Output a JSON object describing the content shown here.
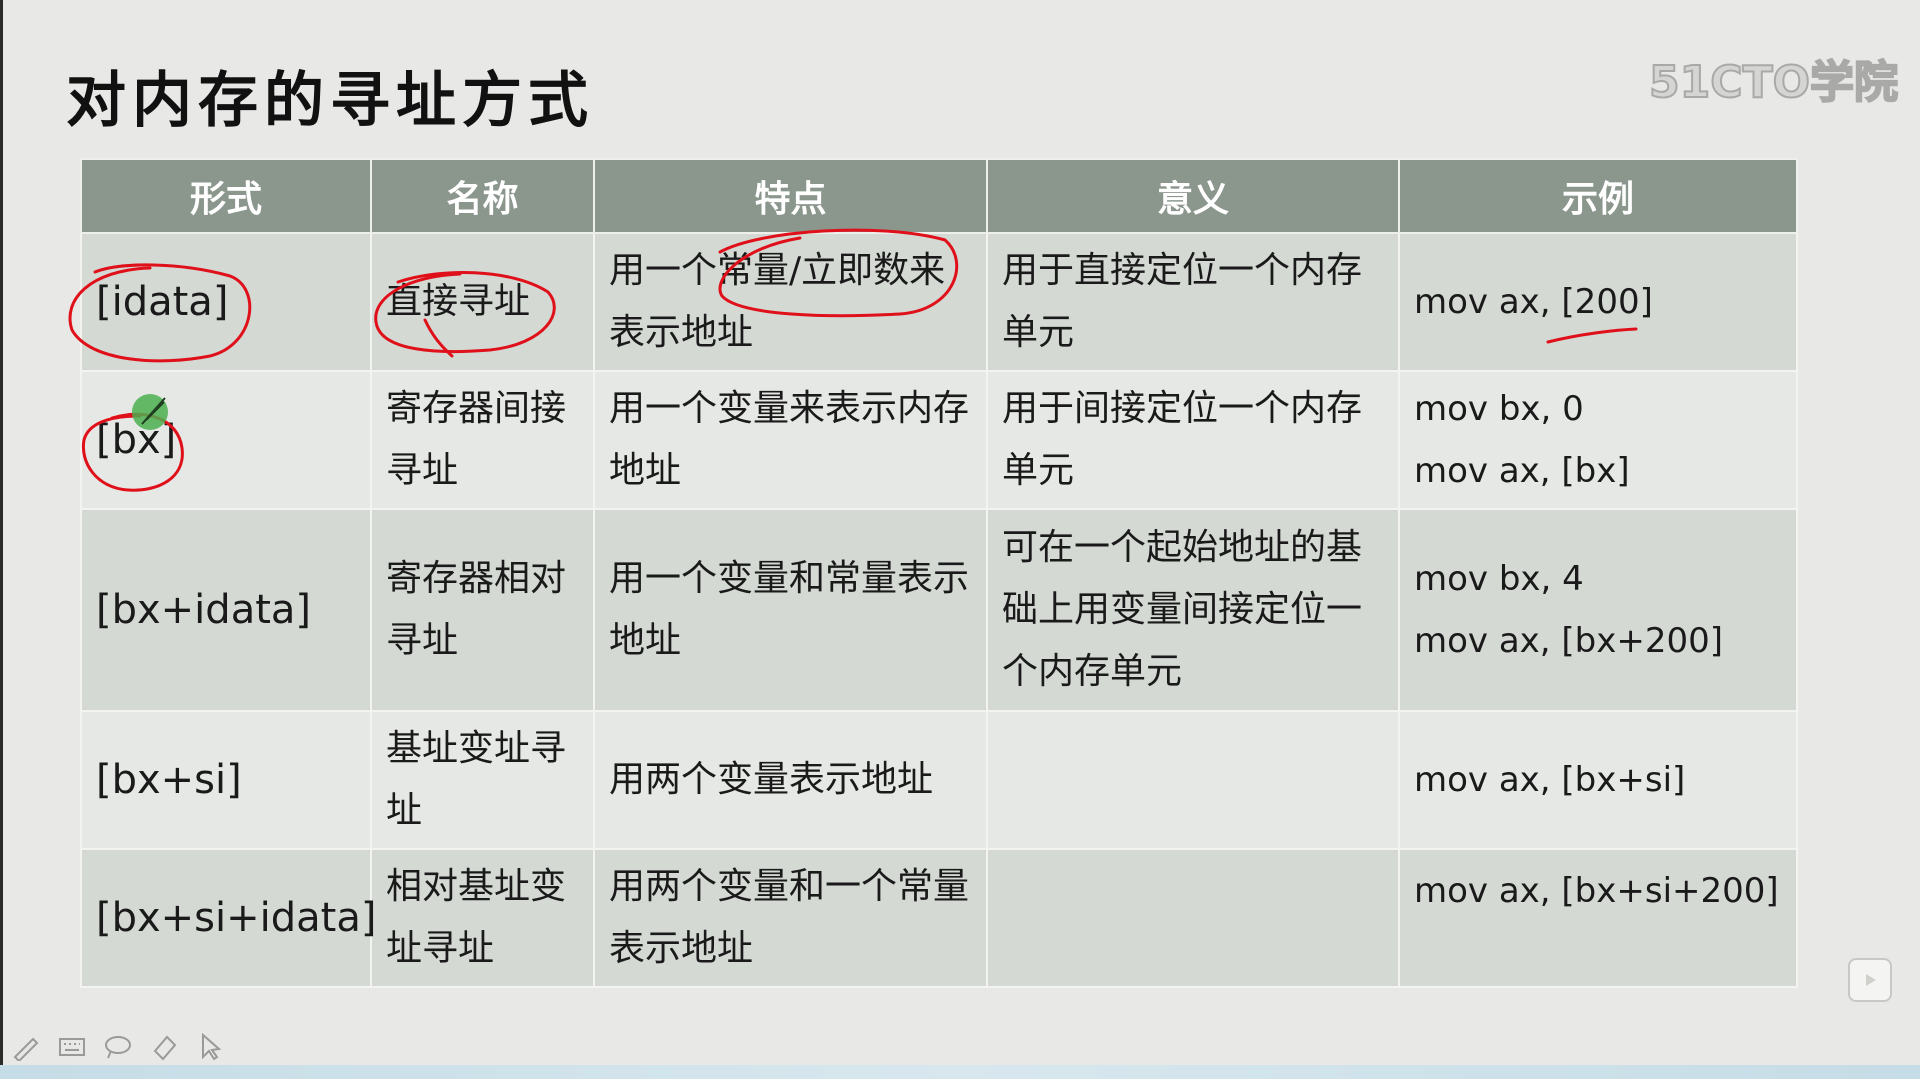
{
  "slide": {
    "title": "对内存的寻址方式",
    "watermark": "51CTO学院"
  },
  "table": {
    "headers": [
      "形式",
      "名称",
      "特点",
      "意义",
      "示例"
    ],
    "rows": [
      {
        "form": "[idata]",
        "name": "直接寻址",
        "feature": "用一个常量/立即数来表示地址",
        "meaning": "用于直接定位一个内存单元",
        "example": [
          "mov ax, [200]"
        ]
      },
      {
        "form": "[bx]",
        "name": "寄存器间接寻址",
        "feature": "用一个变量来表示内存地址",
        "meaning": "用于间接定位一个内存单元",
        "example": [
          "mov bx, 0",
          "mov ax, [bx]"
        ]
      },
      {
        "form": "[bx+idata]",
        "name": "寄存器相对寻址",
        "feature": "用一个变量和常量表示地址",
        "meaning": "可在一个起始地址的基础上用变量间接定位一个内存单元",
        "example": [
          "mov bx, 4",
          "mov ax, [bx+200]"
        ]
      },
      {
        "form": "[bx+si]",
        "name": "基址变址寻址",
        "feature": "用两个变量表示地址",
        "meaning": "",
        "example": [
          "mov ax, [bx+si]"
        ]
      },
      {
        "form": "[bx+si+idata]",
        "name": "相对基址变址寻址",
        "feature": "用两个变量和一个常量表示地址",
        "meaning": "",
        "example": [
          "mov ax, [bx+si+200]"
        ]
      }
    ]
  },
  "colors": {
    "header_bg": "#8b968d",
    "row_odd": "#d4d9d4",
    "row_even": "#e5e8e4",
    "ink_annotation": "#e0101a",
    "pointer_dot": "#4caf50"
  },
  "toolbar": {
    "icons": [
      "pen-icon",
      "keyboard-icon",
      "lasso-icon",
      "eraser-icon",
      "pointer-icon"
    ]
  }
}
